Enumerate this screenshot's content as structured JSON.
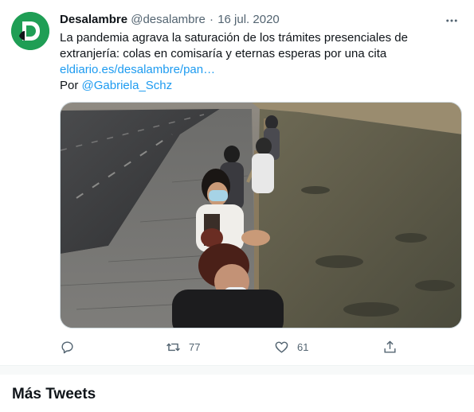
{
  "tweet": {
    "author_name": "Desalambre",
    "handle": "@desalambre",
    "separator": "·",
    "date": "16 jul. 2020",
    "text_line": "La pandemia agrava la saturación de los trámites presenciales de extranjería: colas en comisaría y eternas esperas por una cita",
    "link": "eldiario.es/desalambre/pan…",
    "by_prefix": "Por ",
    "by_handle": "@Gabriela_Schz",
    "avatar_letter": "D",
    "colors": {
      "brand": "#1f9e55",
      "link": "#1d9bf0",
      "muted": "#536471"
    }
  },
  "actions": {
    "reply_icon": "reply-icon",
    "retweet_icon": "retweet-icon",
    "retweet_count": "77",
    "like_icon": "heart-icon",
    "like_count": "61",
    "share_icon": "share-icon"
  },
  "section": {
    "title": "Más Tweets"
  }
}
